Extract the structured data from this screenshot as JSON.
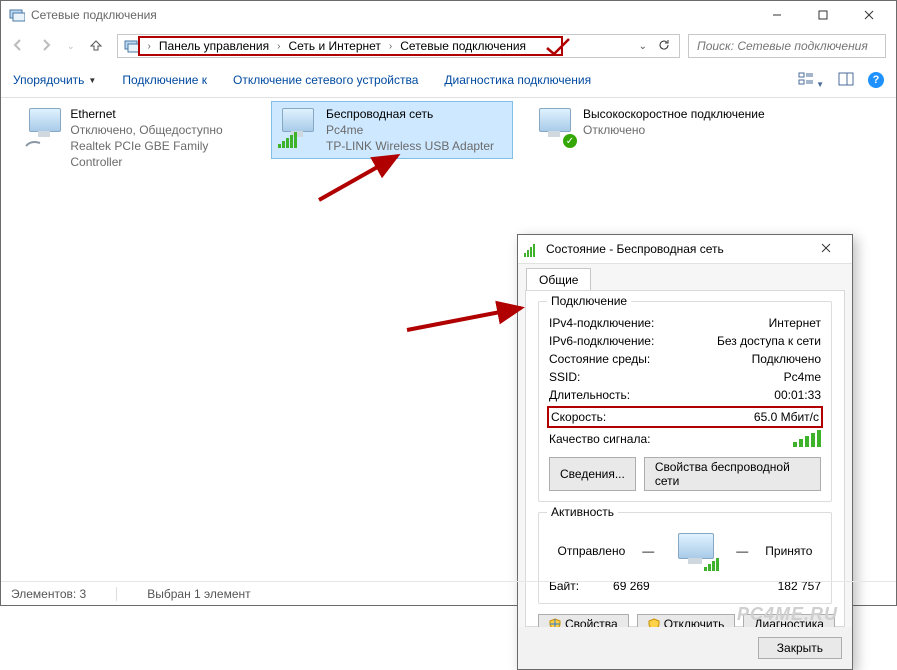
{
  "window": {
    "title": "Сетевые подключения",
    "btn_min": "−",
    "btn_max": "□",
    "btn_close": "✕"
  },
  "breadcrumb": {
    "item1": "Панель управления",
    "item2": "Сеть и Интернет",
    "item3": "Сетевые подключения",
    "dropdown": "⌄",
    "refresh": "↻"
  },
  "search": {
    "placeholder": "Поиск: Сетевые подключения"
  },
  "toolbar": {
    "organize": "Упорядочить",
    "connect_to": "Подключение к",
    "disable": "Отключение сетевого устройства",
    "diagnose": "Диагностика подключения"
  },
  "connections": [
    {
      "name": "Ethernet",
      "line2": "Отключено, Общедоступно",
      "line3": "Realtek PCIe GBE Family Controller"
    },
    {
      "name": "Беспроводная сеть",
      "line2": "Pc4me",
      "line3": "TP-LINK Wireless USB Adapter"
    },
    {
      "name": "Высокоскоростное подключение",
      "line2": "Отключено",
      "line3": ""
    }
  ],
  "statusbar": {
    "elements": "Элементов: 3",
    "selected": "Выбран 1 элемент"
  },
  "dialog": {
    "title": "Состояние - Беспроводная сеть",
    "tab_general": "Общие",
    "group_conn": "Подключение",
    "rows": {
      "ipv4_k": "IPv4-подключение:",
      "ipv4_v": "Интернет",
      "ipv6_k": "IPv6-подключение:",
      "ipv6_v": "Без доступа к сети",
      "media_k": "Состояние среды:",
      "media_v": "Подключено",
      "ssid_k": "SSID:",
      "ssid_v": "Pc4me",
      "dur_k": "Длительность:",
      "dur_v": "00:01:33",
      "speed_k": "Скорость:",
      "speed_v": "65.0 Мбит/с",
      "signal_k": "Качество сигнала:"
    },
    "btn_details": "Сведения...",
    "btn_wireless_props": "Свойства беспроводной сети",
    "group_activity": "Активность",
    "sent_label": "Отправлено",
    "recv_label": "Принято",
    "bytes_label": "Байт:",
    "bytes_sent": "69 269",
    "bytes_recv": "182 757",
    "btn_props": "Свойства",
    "btn_disable": "Отключить",
    "btn_diag": "Диагностика",
    "btn_close": "Закрыть",
    "dash": "—"
  },
  "watermark": "PC4ME.RU"
}
